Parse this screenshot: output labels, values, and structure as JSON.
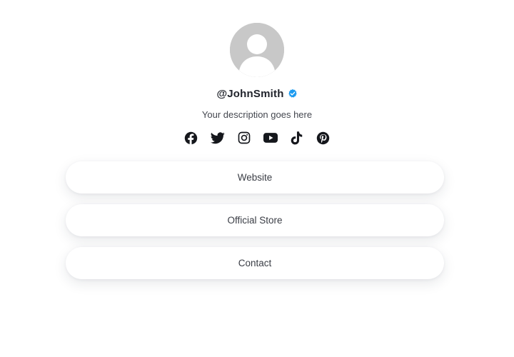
{
  "profile": {
    "avatar_icon": "default-user-avatar",
    "username": "@JohnSmith",
    "verified_icon": "verified-badge-icon",
    "verified_color": "#1d9bf0",
    "description": "Your description goes here"
  },
  "socials": [
    {
      "name": "facebook",
      "icon": "facebook-icon"
    },
    {
      "name": "twitter",
      "icon": "twitter-icon"
    },
    {
      "name": "instagram",
      "icon": "instagram-icon"
    },
    {
      "name": "youtube",
      "icon": "youtube-icon"
    },
    {
      "name": "tiktok",
      "icon": "tiktok-icon"
    },
    {
      "name": "pinterest",
      "icon": "pinterest-icon"
    }
  ],
  "links": [
    {
      "label": "Website"
    },
    {
      "label": "Official Store"
    },
    {
      "label": "Contact"
    }
  ],
  "colors": {
    "background": "#ffffff",
    "icon": "#15171c",
    "avatar_bg": "#c8c8c8",
    "text": "#20232b"
  }
}
